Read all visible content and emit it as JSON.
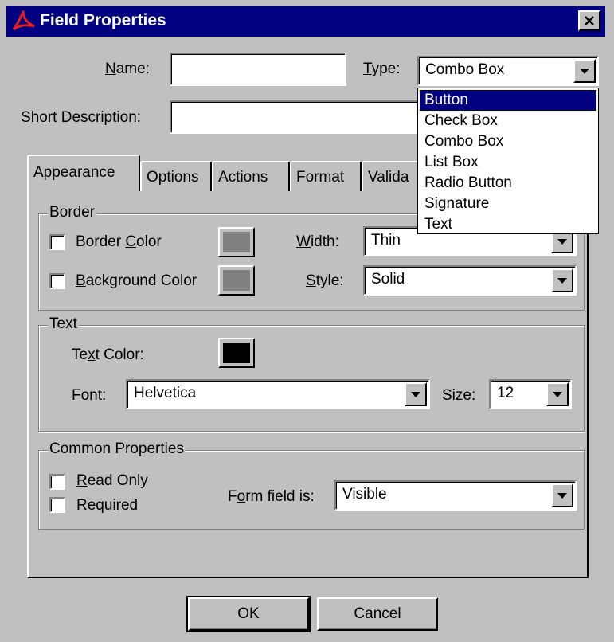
{
  "window": {
    "title": "Field Properties"
  },
  "name": {
    "label": "Name:",
    "value": ""
  },
  "type": {
    "label": "Type:",
    "value": "Combo Box"
  },
  "short_description": {
    "label": "Short Description:",
    "value": ""
  },
  "tabs": [
    {
      "label": "Appearance"
    },
    {
      "label": "Options"
    },
    {
      "label": "Actions"
    },
    {
      "label": "Format"
    },
    {
      "label": "Valida"
    }
  ],
  "type_options": [
    "Button",
    "Check Box",
    "Combo Box",
    "List Box",
    "Radio Button",
    "Signature",
    "Text"
  ],
  "border_group": {
    "title": "Border",
    "border_color_label": "Border Color",
    "background_color_label": "Background Color",
    "width_label": "Width:",
    "width_value": "Thin",
    "style_label": "Style:",
    "style_value": "Solid",
    "border_swatch_color": "#808080",
    "background_swatch_color": "#808080"
  },
  "text_group": {
    "title": "Text",
    "text_color_label": "Text Color:",
    "text_swatch_color": "#000000",
    "font_label": "Font:",
    "font_value": "Helvetica",
    "size_label": "Size:",
    "size_value": "12"
  },
  "common_group": {
    "title": "Common Properties",
    "read_only_label": "Read Only",
    "required_label": "Required",
    "form_field_label": "Form field is:",
    "form_field_value": "Visible"
  },
  "buttons": {
    "ok": "OK",
    "cancel": "Cancel"
  }
}
